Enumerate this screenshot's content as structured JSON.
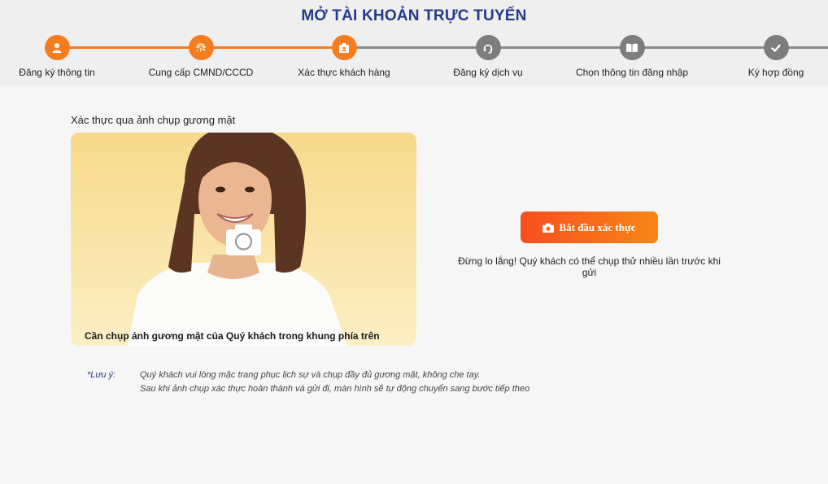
{
  "header": {
    "title": "MỞ TÀI KHOẢN TRỰC TUYẾN"
  },
  "steps": [
    {
      "label": "Đăng ký thông tin",
      "icon": "user-icon",
      "state": "done"
    },
    {
      "label": "Cung cấp CMND/CCCD",
      "icon": "fingerprint-icon",
      "state": "done"
    },
    {
      "label": "Xác thực khách hàng",
      "icon": "id-card-icon",
      "state": "current"
    },
    {
      "label": "Đăng ký dịch vụ",
      "icon": "headset-icon",
      "state": "pending"
    },
    {
      "label": "Chọn thông tin đăng nhập",
      "icon": "book-icon",
      "state": "pending"
    },
    {
      "label": "Ký hợp đồng",
      "icon": "check-icon",
      "state": "pending"
    }
  ],
  "verification": {
    "section_title": "Xác thực qua ảnh chụp gương mặt",
    "photo_caption": "Cần chụp ảnh gương mặt của Quý khách trong khung phía trên",
    "start_button": "Bắt đầu xác thực",
    "hint": "Đừng lo lắng! Quý khách có thể chụp thử nhiều lần trước khi gửi"
  },
  "note": {
    "label": "*Lưu ý:",
    "lines": [
      "Quý khách vui lòng mặc trang phục lịch sự và chụp đầy đủ gương mặt, không che tay.",
      "Sau khi ảnh chụp xác thực hoàn thành và gửi đi, màn hình sẽ tự động chuyển sang bước tiếp theo"
    ]
  },
  "colors": {
    "accent": "#f57c1f",
    "title": "#233b8c",
    "inactive": "#7d7d7d"
  }
}
